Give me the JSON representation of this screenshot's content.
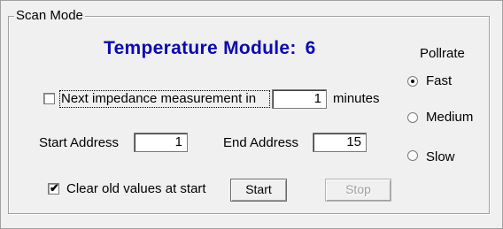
{
  "group": {
    "title": "Scan Mode"
  },
  "header": {
    "title": "Temperature Module:",
    "module_number": "6",
    "title_color": "#0a0ab4"
  },
  "impedance": {
    "checked": false,
    "label": "Next impedance measurement in",
    "value": "1",
    "unit": "minutes"
  },
  "address": {
    "start_label": "Start Address",
    "start_value": "1",
    "end_label": "End Address",
    "end_value": "15"
  },
  "clear_values": {
    "checked": true,
    "checkmark": "✔",
    "label": "Clear old values at start"
  },
  "buttons": {
    "start_label": "Start",
    "stop_label": "Stop",
    "stop_enabled": false
  },
  "pollrate": {
    "title": "Pollrate",
    "selected": "Fast",
    "options": [
      {
        "label": "Fast"
      },
      {
        "label": "Medium"
      },
      {
        "label": "Slow"
      }
    ]
  }
}
